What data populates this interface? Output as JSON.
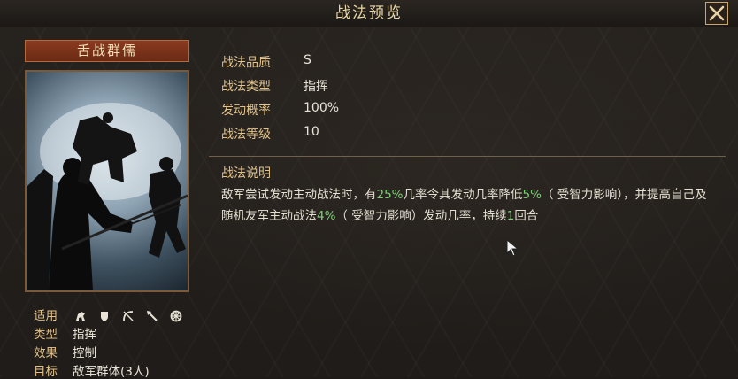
{
  "window": {
    "title": "战法预览"
  },
  "skill": {
    "name": "舌战群儒",
    "stats": [
      {
        "label": "战法品质",
        "value": "S"
      },
      {
        "label": "战法类型",
        "value": "指挥"
      },
      {
        "label": "发动概率",
        "value": "100%"
      },
      {
        "label": "战法等级",
        "value": "10"
      }
    ],
    "desc_label": "战法说明",
    "desc_parts": {
      "p1": "敌军尝试发动主动战法时，有",
      "v1": "25%",
      "p2": "几率令其发动几率降低",
      "v2": "5%",
      "p3": "（ 受智力影响），并提高自己及随机友军主动战法",
      "v3": "4%",
      "p4": "（ 受智力影响）发动几率，持续",
      "v4": "1",
      "p5": "回合"
    }
  },
  "attributes": {
    "applicable_label": "适用",
    "applicable_icons": [
      "cavalry-icon",
      "shield-icon",
      "bow-icon",
      "spear-icon",
      "wheel-icon"
    ],
    "type_label": "类型",
    "type_value": "指挥",
    "effect_label": "效果",
    "effect_value": "控制",
    "target_label": "目标",
    "target_value": "敌军群体(3人)"
  },
  "colors": {
    "label": "#e3c389",
    "highlight": "#7fd07a",
    "nameplate": "#7a3219"
  }
}
